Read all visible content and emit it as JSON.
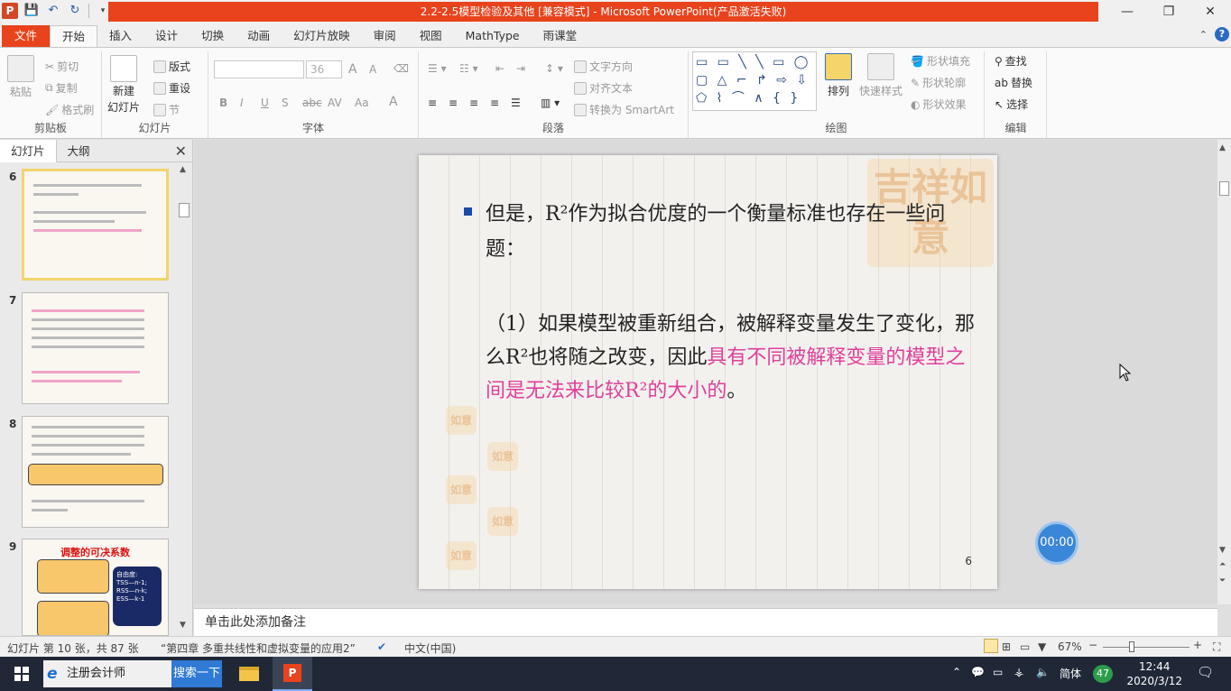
{
  "window": {
    "title": "2.2-2.5模型检验及其他 [兼容模式] - Microsoft PowerPoint(产品激活失败)",
    "minimize": "—",
    "maximize": "❐",
    "close": "✕"
  },
  "qat": {
    "logo": "P",
    "save": "💾",
    "undo": "↶",
    "redo": "↻"
  },
  "ribbon_tabs": [
    "文件",
    "开始",
    "插入",
    "设计",
    "切换",
    "动画",
    "幻灯片放映",
    "审阅",
    "视图",
    "MathType",
    "雨课堂"
  ],
  "ribbon": {
    "clipboard": {
      "label": "剪贴板",
      "paste": "粘贴",
      "cut": "剪切",
      "copy": "复制",
      "format_painter": "格式刷"
    },
    "slides": {
      "label": "幻灯片",
      "new_slide_1": "新建",
      "new_slide_2": "幻灯片",
      "layout": "版式",
      "reset": "重设",
      "section": "节"
    },
    "font": {
      "label": "字体",
      "font_name": "",
      "font_size": "36",
      "grow": "A",
      "shrink": "A",
      "bold": "B",
      "italic": "I",
      "underline": "U",
      "shadow": "S",
      "strike": "abc",
      "spacing": "AV",
      "case": "Aa",
      "color": "A"
    },
    "paragraph": {
      "label": "段落",
      "text_direction": "文字方向",
      "align_text": "对齐文本",
      "smartart": "转换为 SmartArt"
    },
    "drawing": {
      "label": "绘图",
      "shapes_row1": "▭ ▭ ╲ ╲ ▭ ◯",
      "shapes_row2": "▢ △ ⌐ ↱ ⇨ ⇩",
      "shapes_row3": "⬠ ⌇ ⌒ ∧ { }",
      "arrange": "排列",
      "quick_styles": "快速样式",
      "shape_fill": "形状填充",
      "shape_outline": "形状轮廓",
      "shape_effects": "形状效果"
    },
    "editing": {
      "label": "编辑",
      "find": "查找",
      "replace": "替换",
      "select": "选择"
    }
  },
  "left_panel": {
    "tabs": [
      "幻灯片",
      "大纲"
    ],
    "close": "✕",
    "thumbs": [
      {
        "num": "6",
        "title": ""
      },
      {
        "num": "7",
        "title": ""
      },
      {
        "num": "8",
        "title": ""
      },
      {
        "num": "9",
        "title": "调整的可决系数"
      }
    ],
    "thumb9_box": "自由度:\nTSS—n-1;\nRSS—n-k;\nESS—k-1"
  },
  "slide": {
    "bullet_text": "但是，R²作为拟合优度的一个衡量标准也存在一些问题：",
    "para_normal": "（1）如果模型被重新组合，被解释变量发生了变化，那么R²也将随之改变，因此",
    "para_pink": "具有不同被解释变量的模型之间是无法来比较R²的大小的",
    "para_end": "。",
    "page_number": "6",
    "seal_big": "吉祥如意",
    "seal_small": "如意"
  },
  "timer": "00:00",
  "notes_placeholder": "单击此处添加备注",
  "status": {
    "slide_info": "幻灯片 第 10 张，共 87 张",
    "theme": "“第四章 多重共线性和虚拟变量的应用2”",
    "language": "中文(中国)",
    "zoom": "67%",
    "minus": "−",
    "plus": "+"
  },
  "taskbar": {
    "search_app": "注册会计师",
    "search_button": "搜索一下",
    "ime": "简体",
    "badge": "47",
    "time": "12:44",
    "date": "2020/3/12"
  },
  "colors": {
    "accent": "#e8431c",
    "highlight_text": "#e0409a",
    "bullet": "#1a4aa8"
  }
}
